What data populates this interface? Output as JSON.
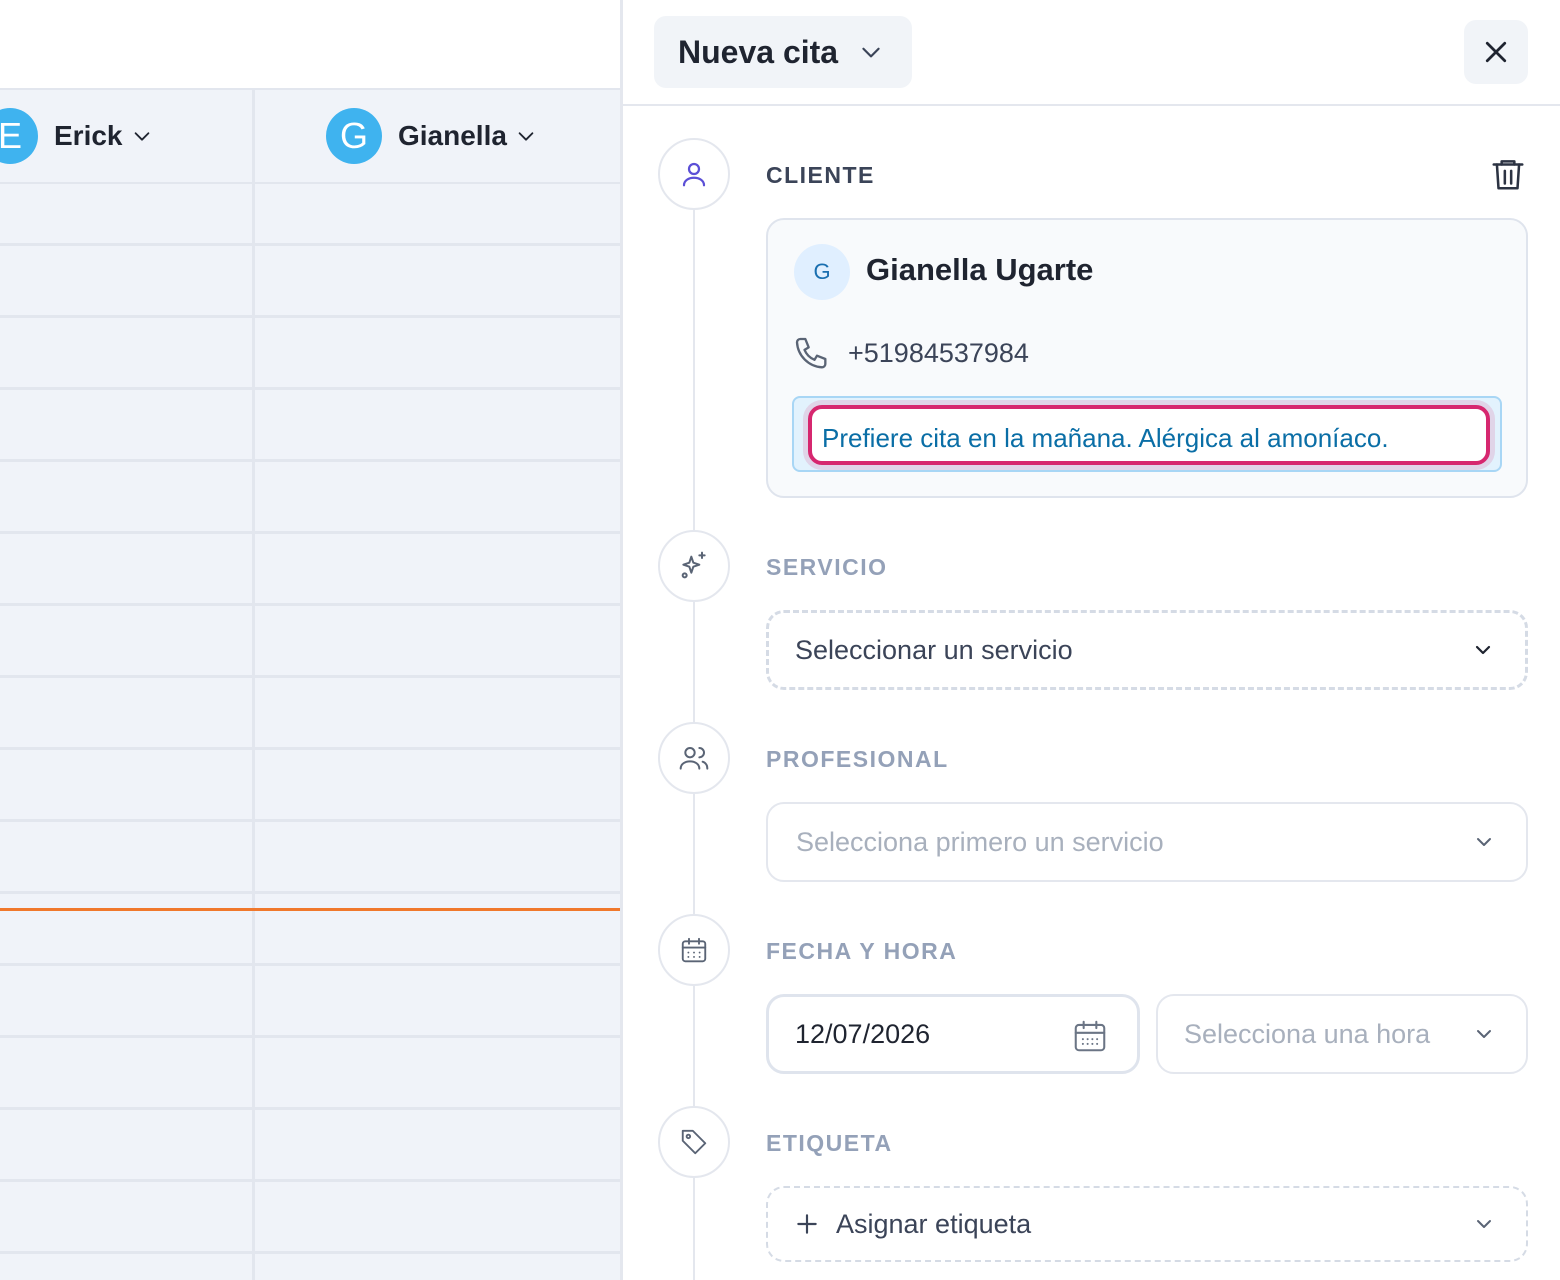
{
  "calendar": {
    "staff": [
      {
        "initial": "E",
        "name": "Erick"
      },
      {
        "initial": "G",
        "name": "Gianella"
      }
    ],
    "colors": {
      "avatar": "#3fb3ef",
      "now_line": "#f0782c"
    }
  },
  "panel": {
    "title": "Nueva cita",
    "sections": {
      "cliente": "CLIENTE",
      "servicio": "SERVICIO",
      "profesional": "PROFESIONAL",
      "fecha_hora": "FECHA Y HORA",
      "etiqueta": "ETIQUETA"
    },
    "client": {
      "initial": "G",
      "name": "Gianella Ugarte",
      "phone": "+51984537984",
      "note": "Prefiere cita en la mañana. Alérgica al amoníaco."
    },
    "servicio_select": "Seleccionar un servicio",
    "profesional_select": "Selecciona primero un servicio",
    "fecha": "12/07/2026",
    "hora_select": "Selecciona una hora",
    "etiqueta_button": "Asignar etiqueta",
    "colors": {
      "highlight": "#d6276f",
      "note_text": "#0a6ea6"
    }
  }
}
